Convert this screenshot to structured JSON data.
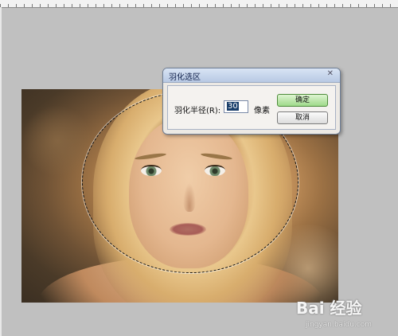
{
  "dialog": {
    "title": "羽化选区",
    "label": "羽化半径(R):",
    "value": "30",
    "unit": "像素",
    "ok": "确定",
    "cancel": "取消"
  },
  "watermark": {
    "main": "Bai 经验",
    "sub": "jingyan.baidu.com"
  }
}
